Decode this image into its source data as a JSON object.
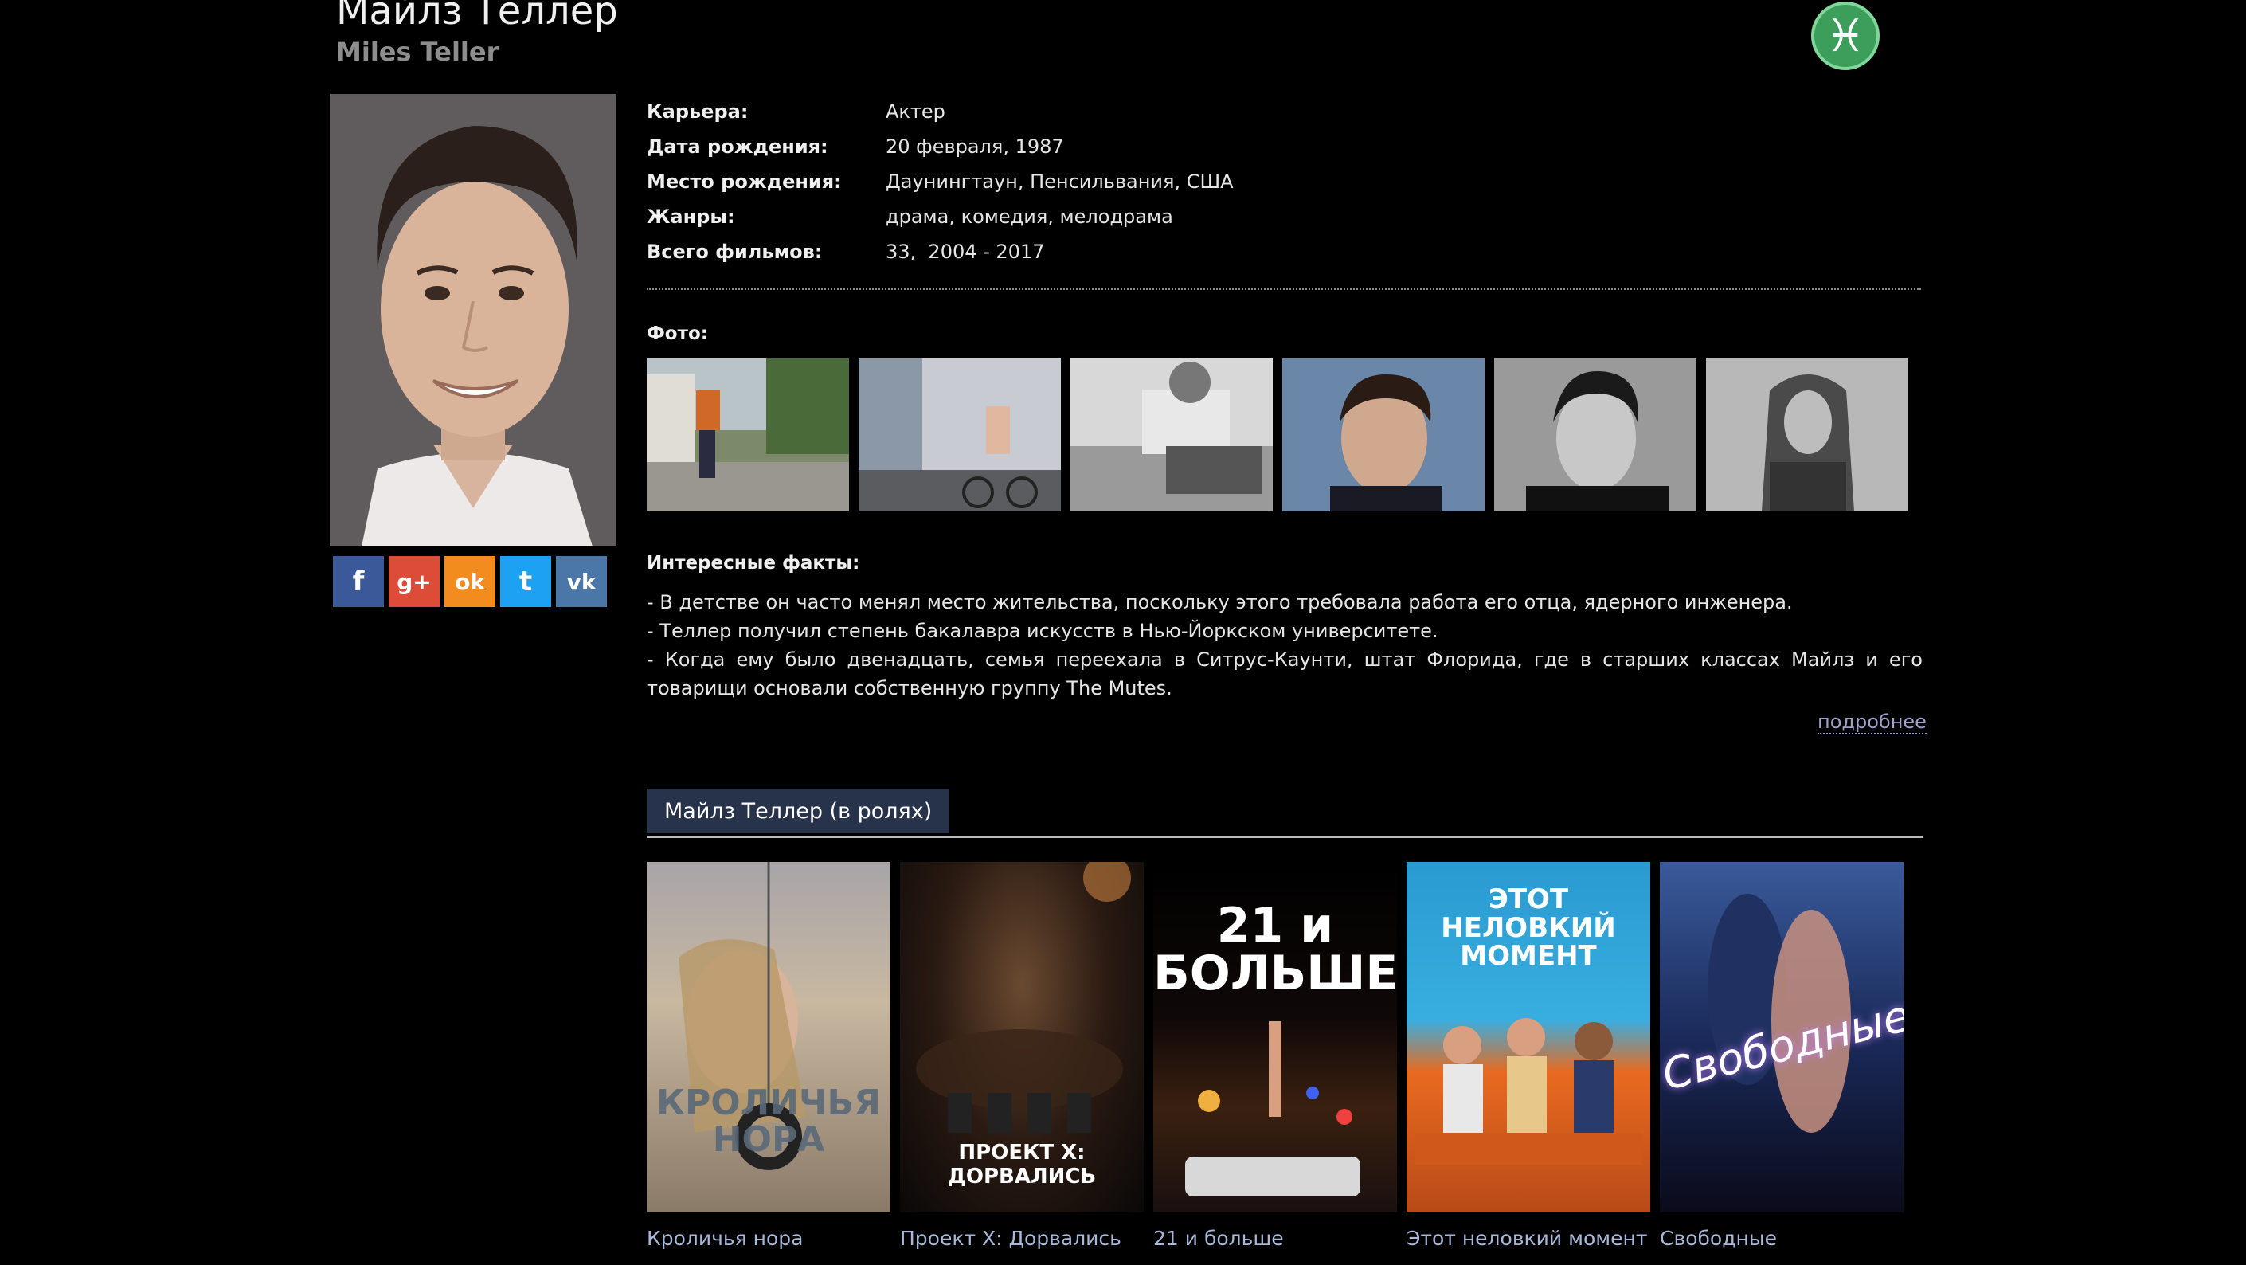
{
  "header": {
    "name_ru": "Майлз Теллер",
    "name_en": "Miles Teller",
    "zodiac_icon": "♓"
  },
  "social": [
    {
      "icon": "facebook-icon",
      "glyph": "f",
      "color": "#3b5998"
    },
    {
      "icon": "google-plus-icon",
      "glyph": "g+",
      "color": "#dd4b39"
    },
    {
      "icon": "odnoklassniki-icon",
      "glyph": "ok",
      "color": "#f28c1e"
    },
    {
      "icon": "twitter-icon",
      "glyph": "t",
      "color": "#1da1f2"
    },
    {
      "icon": "vk-icon",
      "glyph": "vk",
      "color": "#4a76a8"
    }
  ],
  "info": [
    {
      "label": "Карьера:",
      "value": "Актер"
    },
    {
      "label": "Дата рождения:",
      "value": "20 февраля, 1987"
    },
    {
      "label": "Место рождения:",
      "value": "Даунингтаун, Пенсильвания, США"
    },
    {
      "label": "Жанры:",
      "value": "драма, комедия, мелодрама"
    },
    {
      "label": "Всего фильмов:",
      "value": "33,  2004 - 2017"
    }
  ],
  "photos_label": "Фото:",
  "facts_label": "Интересные факты:",
  "facts": [
    "- В детстве он часто менял место жительства, поскольку этого требовала работа его отца, ядерного инженера.",
    "- Теллер получил степень бакалавра искусств в Нью-Йоркском университете.",
    "- Когда ему было двенадцать, семья переехала в Ситрус-Каунти, штат Флорида, где в старших классах Майлз и его товарищи основали собственную группу The Mutes."
  ],
  "more_link": "подробнее",
  "roles_tab": "Майлз Теллер (в ролях)",
  "films": [
    {
      "title": "Кроличья нора",
      "poster_text": "КРОЛИЧЬЯ НОРА"
    },
    {
      "title": "Проект X: Дорвались",
      "poster_text": "ПРОЕКТ X: ДОРВАЛИСЬ"
    },
    {
      "title": "21 и больше",
      "poster_text": "21 и БОЛЬШЕ"
    },
    {
      "title": "Этот неловкий момент",
      "poster_text": "ЭТОТ НЕЛОВКИЙ МОМЕНТ"
    },
    {
      "title": "Свободные",
      "poster_text": "Свободные"
    }
  ]
}
